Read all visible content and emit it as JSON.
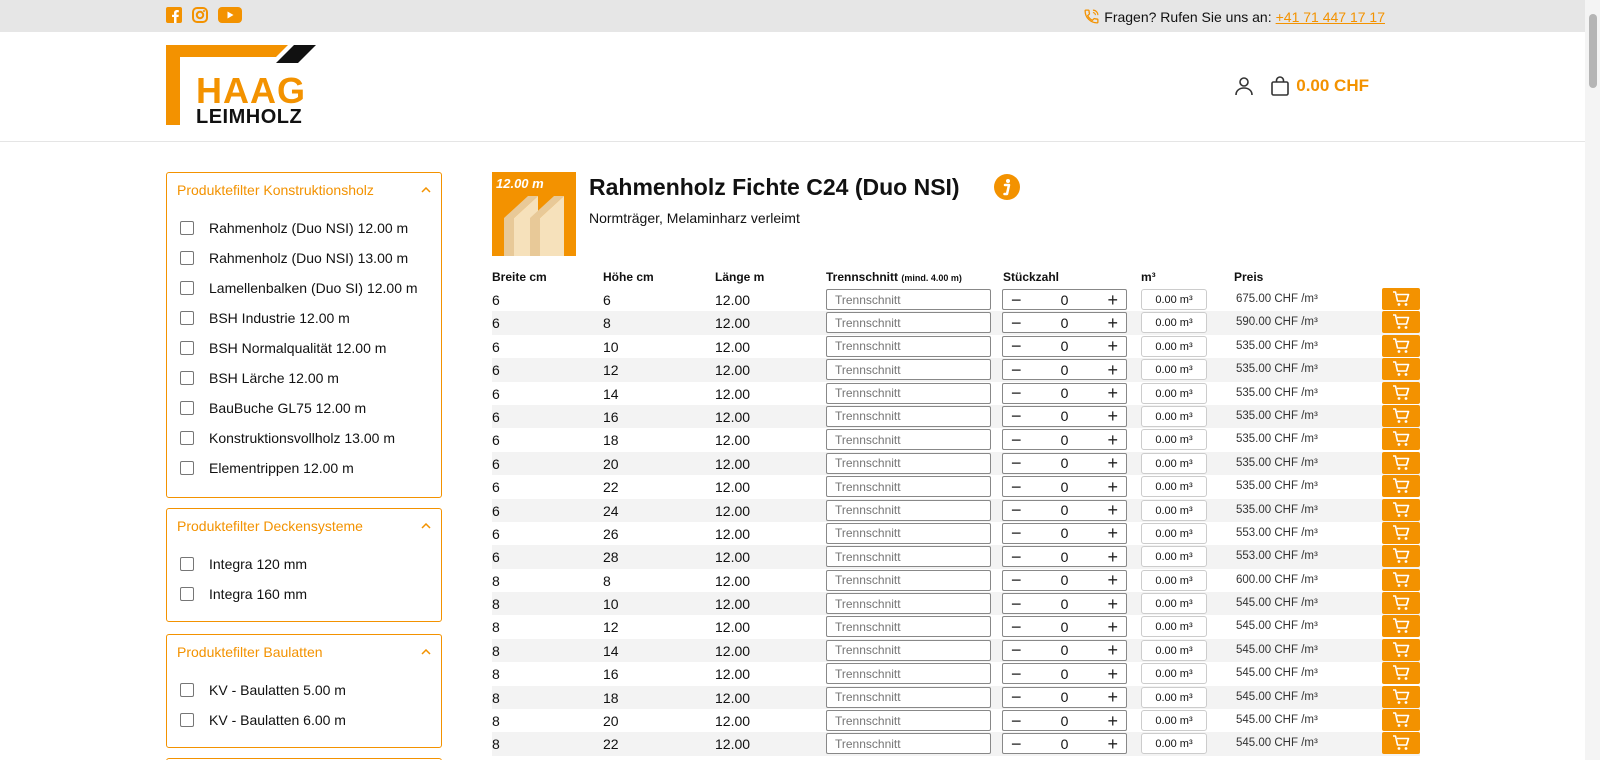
{
  "topbar": {
    "social_icons": [
      "facebook-icon",
      "instagram-icon",
      "youtube-icon"
    ],
    "hotline_text": "Fragen? Rufen Sie uns an:",
    "hotline_number": "+41 71 447 17 17"
  },
  "header": {
    "logo_word1": "HAAG",
    "logo_word2": "LEIMHOLZ",
    "cart_total": "0.00 CHF"
  },
  "colors": {
    "accent": "#f39200",
    "topbar_bg": "#e6e6e6"
  },
  "filters": [
    {
      "title": "Produktefilter Konstruktionsholz",
      "items": [
        "Rahmenholz (Duo NSI) 12.00 m",
        "Rahmenholz (Duo NSI) 13.00 m",
        "Lamellenbalken (Duo SI) 12.00 m",
        "BSH Industrie 12.00 m",
        "BSH Normalqualität 12.00 m",
        "BSH Lärche 12.00 m",
        "BauBuche GL75 12.00 m",
        "Konstruktionsvollholz 13.00 m",
        "Elementrippen 12.00 m"
      ]
    },
    {
      "title": "Produktefilter Deckensysteme",
      "items": [
        "Integra 120 mm",
        "Integra 160 mm"
      ]
    },
    {
      "title": "Produktefilter Baulatten",
      "items": [
        "KV - Baulatten 5.00 m",
        "KV - Baulatten 6.00 m"
      ]
    }
  ],
  "product": {
    "badge": "12.00 m",
    "title": "Rahmenholz Fichte C24 (Duo NSI)",
    "subtitle": "Normträger, Melaminharz verleimt"
  },
  "table": {
    "headers": {
      "breite": "Breite cm",
      "hoehe": "Höhe cm",
      "laenge": "Länge m",
      "trenn": "Trennschnitt",
      "trenn_note": "(mind. 4.00 m)",
      "stueck": "Stückzahl",
      "m3": "m³",
      "preis": "Preis"
    },
    "trenn_placeholder": "Trennschnitt",
    "rows": [
      {
        "b": "6",
        "h": "6",
        "l": "12.00",
        "qty": "0",
        "m3": "0.00 m³",
        "price": "675.00 CHF /m³"
      },
      {
        "b": "6",
        "h": "8",
        "l": "12.00",
        "qty": "0",
        "m3": "0.00 m³",
        "price": "590.00 CHF /m³"
      },
      {
        "b": "6",
        "h": "10",
        "l": "12.00",
        "qty": "0",
        "m3": "0.00 m³",
        "price": "535.00 CHF /m³"
      },
      {
        "b": "6",
        "h": "12",
        "l": "12.00",
        "qty": "0",
        "m3": "0.00 m³",
        "price": "535.00 CHF /m³"
      },
      {
        "b": "6",
        "h": "14",
        "l": "12.00",
        "qty": "0",
        "m3": "0.00 m³",
        "price": "535.00 CHF /m³"
      },
      {
        "b": "6",
        "h": "16",
        "l": "12.00",
        "qty": "0",
        "m3": "0.00 m³",
        "price": "535.00 CHF /m³"
      },
      {
        "b": "6",
        "h": "18",
        "l": "12.00",
        "qty": "0",
        "m3": "0.00 m³",
        "price": "535.00 CHF /m³"
      },
      {
        "b": "6",
        "h": "20",
        "l": "12.00",
        "qty": "0",
        "m3": "0.00 m³",
        "price": "535.00 CHF /m³"
      },
      {
        "b": "6",
        "h": "22",
        "l": "12.00",
        "qty": "0",
        "m3": "0.00 m³",
        "price": "535.00 CHF /m³"
      },
      {
        "b": "6",
        "h": "24",
        "l": "12.00",
        "qty": "0",
        "m3": "0.00 m³",
        "price": "535.00 CHF /m³"
      },
      {
        "b": "6",
        "h": "26",
        "l": "12.00",
        "qty": "0",
        "m3": "0.00 m³",
        "price": "553.00 CHF /m³"
      },
      {
        "b": "6",
        "h": "28",
        "l": "12.00",
        "qty": "0",
        "m3": "0.00 m³",
        "price": "553.00 CHF /m³"
      },
      {
        "b": "8",
        "h": "8",
        "l": "12.00",
        "qty": "0",
        "m3": "0.00 m³",
        "price": "600.00 CHF /m³"
      },
      {
        "b": "8",
        "h": "10",
        "l": "12.00",
        "qty": "0",
        "m3": "0.00 m³",
        "price": "545.00 CHF /m³"
      },
      {
        "b": "8",
        "h": "12",
        "l": "12.00",
        "qty": "0",
        "m3": "0.00 m³",
        "price": "545.00 CHF /m³"
      },
      {
        "b": "8",
        "h": "14",
        "l": "12.00",
        "qty": "0",
        "m3": "0.00 m³",
        "price": "545.00 CHF /m³"
      },
      {
        "b": "8",
        "h": "16",
        "l": "12.00",
        "qty": "0",
        "m3": "0.00 m³",
        "price": "545.00 CHF /m³"
      },
      {
        "b": "8",
        "h": "18",
        "l": "12.00",
        "qty": "0",
        "m3": "0.00 m³",
        "price": "545.00 CHF /m³"
      },
      {
        "b": "8",
        "h": "20",
        "l": "12.00",
        "qty": "0",
        "m3": "0.00 m³",
        "price": "545.00 CHF /m³"
      },
      {
        "b": "8",
        "h": "22",
        "l": "12.00",
        "qty": "0",
        "m3": "0.00 m³",
        "price": "545.00 CHF /m³"
      }
    ]
  }
}
